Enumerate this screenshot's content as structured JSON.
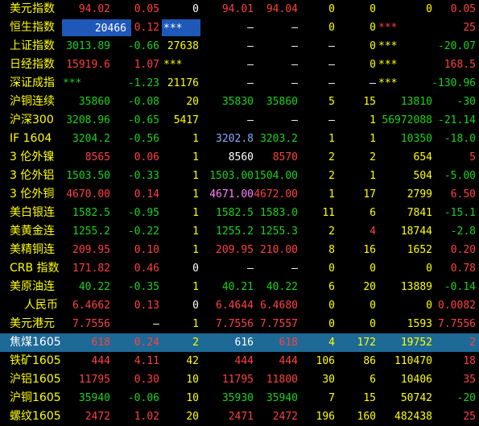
{
  "rows": [
    {
      "name": "美元指数",
      "cols": [
        "94.02",
        "0.05",
        "0",
        "94.01",
        "94.04",
        "0",
        "0",
        "0",
        "0.05"
      ]
    },
    {
      "name": "恒生指数",
      "cols": [
        "20466",
        "0.12",
        "***",
        "—",
        "—",
        "0",
        "0",
        "***",
        "25"
      ]
    },
    {
      "name": "上证指数",
      "cols": [
        "3013.89",
        "-0.66",
        "27638",
        "—",
        "—",
        "—",
        "0",
        "***",
        "-20.07"
      ]
    },
    {
      "name": "日经指数",
      "cols": [
        "15919.6",
        "1.07",
        "***",
        "—",
        "—",
        "—",
        "0",
        "***",
        "168.5"
      ]
    },
    {
      "name": "深证成指",
      "cols": [
        "***",
        "-1.23",
        "21176",
        "—",
        "—",
        "—",
        "—",
        "***",
        "-130.96"
      ]
    },
    {
      "name": "沪铜连续",
      "cols": [
        "35860",
        "-0.08",
        "20",
        "35830",
        "35860",
        "5",
        "15",
        "13810",
        "-30"
      ]
    },
    {
      "name": "沪深300",
      "cols": [
        "3208.96",
        "-0.65",
        "5417",
        "—",
        "—",
        "—",
        "1",
        "56972088",
        "-21.14"
      ]
    },
    {
      "name": "IF  1604",
      "cols": [
        "3204.2",
        "-0.56",
        "1",
        "3202.8",
        "3203.2",
        "1",
        "1",
        "10350",
        "-18.0"
      ]
    },
    {
      "name": "3 伦外镍",
      "cols": [
        "8565",
        "0.06",
        "1",
        "8560",
        "8570",
        "2",
        "2",
        "654",
        "5"
      ]
    },
    {
      "name": "3 伦外铝",
      "cols": [
        "1503.50",
        "-0.33",
        "1",
        "1503.00",
        "1504.00",
        "2",
        "1",
        "504",
        "-5.00"
      ]
    },
    {
      "name": "3 伦外铜",
      "cols": [
        "4670.00",
        "0.14",
        "1",
        "4671.00",
        "4672.00",
        "1",
        "17",
        "2799",
        "6.50"
      ]
    },
    {
      "name": "美白银连",
      "cols": [
        "1582.5",
        "-0.95",
        "1",
        "1582.5",
        "1583.0",
        "11",
        "6",
        "7841",
        "-15.1"
      ]
    },
    {
      "name": "美黄金连",
      "cols": [
        "1255.2",
        "-0.22",
        "1",
        "1255.2",
        "1255.3",
        "2",
        "4",
        "18744",
        "-2.8"
      ]
    },
    {
      "name": "美精铜连",
      "cols": [
        "209.95",
        "0.10",
        "1",
        "209.95",
        "210.00",
        "8",
        "16",
        "1652",
        "0.20"
      ]
    },
    {
      "name": "CRB 指数",
      "cols": [
        "171.82",
        "0.46",
        "0",
        "—",
        "—",
        "0",
        "0",
        "0",
        "0.78"
      ]
    },
    {
      "name": "美原油连",
      "cols": [
        "40.22",
        "-0.35",
        "1",
        "40.21",
        "40.22",
        "6",
        "20",
        "13889",
        "-0.14"
      ]
    },
    {
      "name": "人民币",
      "cols": [
        "6.4662",
        "0.13",
        "0",
        "6.4644",
        "6.4680",
        "0",
        "0",
        "0",
        "0.0082"
      ]
    },
    {
      "name": "美元港元",
      "cols": [
        "7.7556",
        "—",
        "1",
        "7.7556",
        "7.7557",
        "0",
        "0",
        "1593",
        "7.7556"
      ]
    },
    {
      "name": "焦煤1605",
      "cols": [
        "618",
        "0.24",
        "2",
        "616",
        "618",
        "4",
        "172",
        "19752",
        "2"
      ]
    },
    {
      "name": "铁矿1605",
      "cols": [
        "444",
        "4.11",
        "42",
        "444",
        "444",
        "106",
        "86",
        "110470",
        "18"
      ]
    },
    {
      "name": "沪铝1605",
      "cols": [
        "11795",
        "0.30",
        "10",
        "11795",
        "11800",
        "30",
        "6",
        "10406",
        "35"
      ]
    },
    {
      "name": "沪铜1605",
      "cols": [
        "35940",
        "-0.06",
        "10",
        "35930",
        "35940",
        "7",
        "15",
        "50742",
        "-20"
      ]
    },
    {
      "name": "螺纹1605",
      "cols": [
        "2472",
        "1.02",
        "20",
        "2471",
        "2472",
        "196",
        "160",
        "482438",
        "25"
      ]
    }
  ]
}
